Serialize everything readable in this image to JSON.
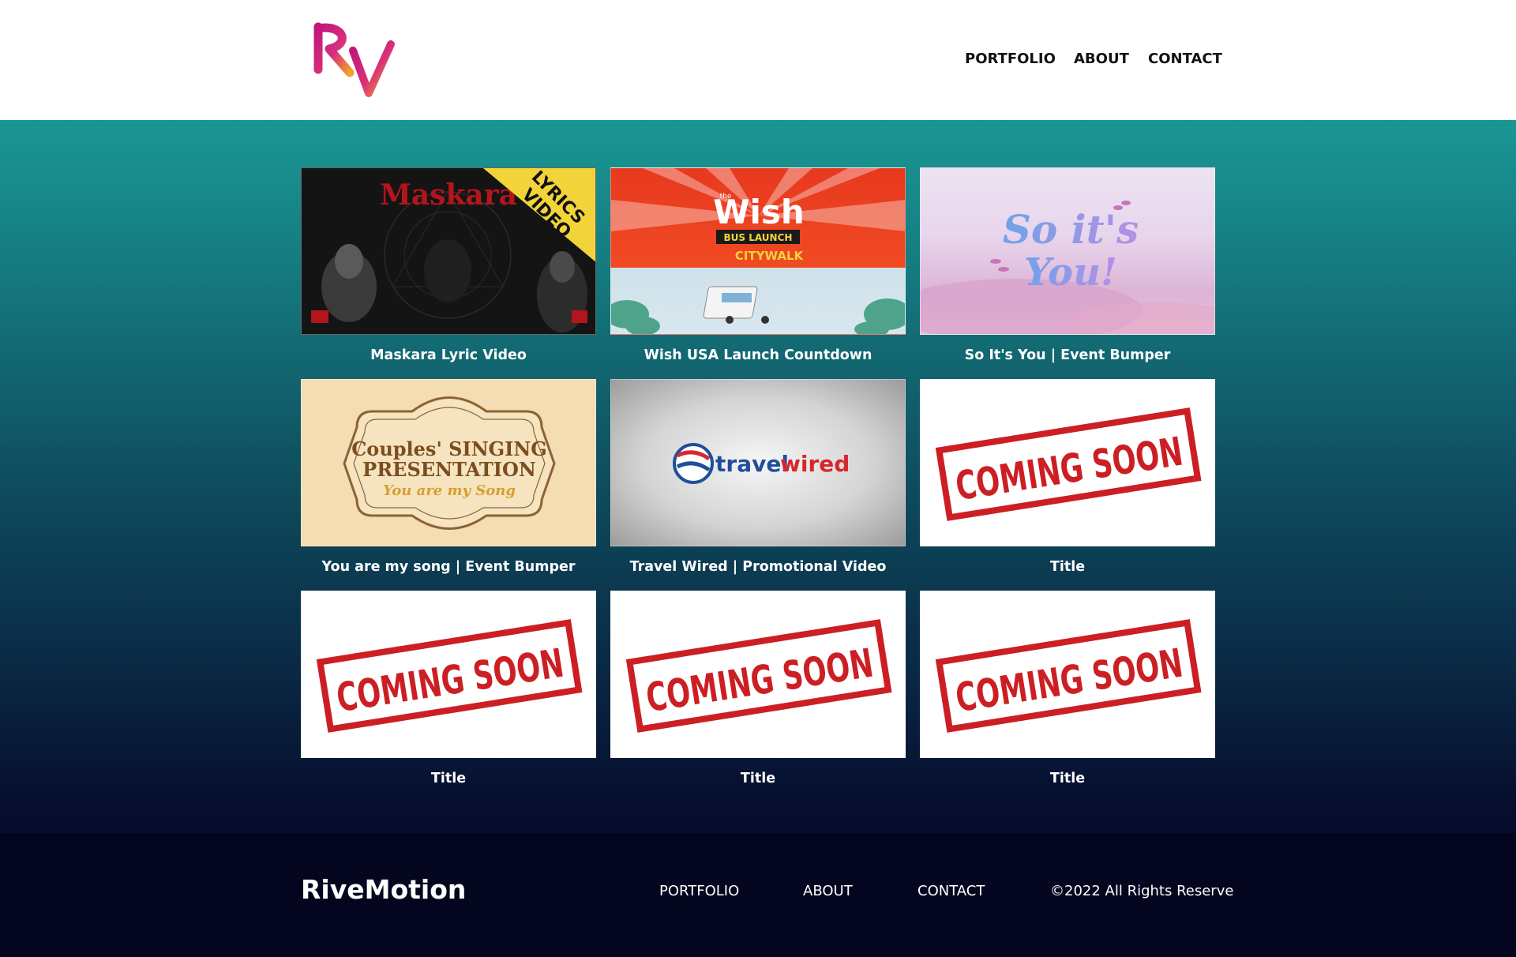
{
  "header": {
    "logo_text": "Rv",
    "nav": [
      {
        "label": "PORTFOLIO"
      },
      {
        "label": "ABOUT"
      },
      {
        "label": "CONTACT"
      }
    ]
  },
  "portfolio": {
    "items": [
      {
        "title": "Maskara Lyric Video",
        "thumb": "maskara",
        "thumb_text": [
          "Maskara",
          "LYRICS",
          "VIDEO"
        ]
      },
      {
        "title": "Wish USA Launch Countdown",
        "thumb": "wish",
        "thumb_text": [
          "the",
          "Wish",
          "BUS LAUNCH",
          "CITYWALK"
        ]
      },
      {
        "title": "So It's You | Event Bumper",
        "thumb": "soitsyou",
        "thumb_text": [
          "So it's",
          "You!"
        ]
      },
      {
        "title": "You are my song | Event Bumper",
        "thumb": "couples",
        "thumb_text": [
          "Couples' SINGING",
          "PRESENTATION",
          "You are my Song"
        ]
      },
      {
        "title": "Travel Wired | Promotional Video",
        "thumb": "travel",
        "thumb_text": [
          "travel",
          "wired"
        ]
      },
      {
        "title": "Title",
        "thumb": "soon",
        "thumb_text": [
          "COMING SOON"
        ]
      },
      {
        "title": "Title",
        "thumb": "soon",
        "thumb_text": [
          "COMING SOON"
        ]
      },
      {
        "title": "Title",
        "thumb": "soon",
        "thumb_text": [
          "COMING SOON"
        ]
      },
      {
        "title": "Title",
        "thumb": "soon",
        "thumb_text": [
          "COMING SOON"
        ]
      }
    ]
  },
  "footer": {
    "brand": "RiveMotion",
    "nav": [
      {
        "label": "PORTFOLIO"
      },
      {
        "label": "ABOUT"
      },
      {
        "label": "CONTACT"
      }
    ],
    "copyright": "©2022 All Rights Reserve"
  },
  "colors": {
    "gradient_top": "#1a9793",
    "gradient_bottom": "#050626",
    "footer_bg": "#04061f",
    "stamp_red": "#cc1f24",
    "logo_gradient": [
      "#c0157a",
      "#f0a22e"
    ]
  }
}
